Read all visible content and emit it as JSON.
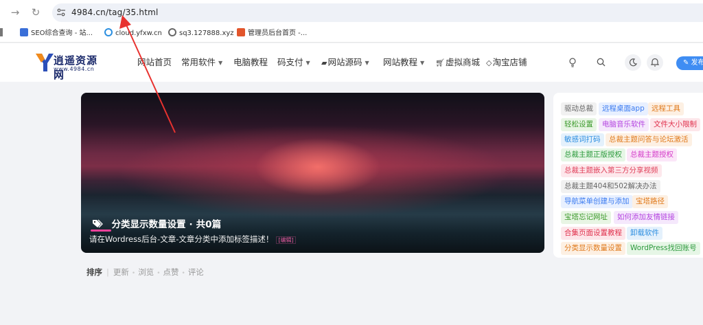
{
  "browser": {
    "address": "4984.cn/tag/35.html",
    "bookmarks": [
      {
        "label": "SEO综合查询 - 站...",
        "icon": "seo-favicon",
        "color": "#3a6fd8"
      },
      {
        "label": "cloud.yfxw.cn",
        "icon": "cloud-favicon",
        "color": "#2b8fe0"
      },
      {
        "label": "sq3.127888.xyz",
        "icon": "globe-icon",
        "color": "#666666"
      },
      {
        "label": "管理员后台首页 -...",
        "icon": "k-favicon",
        "color": "#e2552b"
      }
    ]
  },
  "site": {
    "logo_title": "逍遥资源网",
    "logo_sub": "www.4984.cn",
    "menu": [
      {
        "label": "网站首页",
        "glyph": "",
        "caret": false
      },
      {
        "label": "常用软件",
        "glyph": "",
        "caret": true
      },
      {
        "label": "电脑教程",
        "glyph": "",
        "caret": false
      },
      {
        "label": "码支付",
        "glyph": "",
        "caret": true
      },
      {
        "label": "网站源码",
        "glyph": "folder-icon",
        "caret": true
      },
      {
        "label": "网站教程",
        "glyph": "",
        "caret": true
      },
      {
        "label": "虚拟商城",
        "glyph": "cart-icon",
        "caret": false
      },
      {
        "label": "淘宝店铺",
        "glyph": "diamond-icon",
        "caret": false
      }
    ],
    "publish_label": "✎ 发布"
  },
  "banner": {
    "tag_name": "分类显示数量设置",
    "count_text": "共0篇",
    "description": "请在Wordress后台-文章-文章分类中添加标签描述！",
    "edit_label": "[编辑]"
  },
  "sort": {
    "label": "排序",
    "options": [
      "更新",
      "浏览",
      "点赞",
      "评论"
    ]
  },
  "tags": [
    {
      "label": "驱动总裁",
      "color": "#666666",
      "bg": "#f1f1f1"
    },
    {
      "label": "远程桌面app",
      "color": "#3b7bf0",
      "bg": "#e8f0ff"
    },
    {
      "label": "远程工具",
      "color": "#e07a1c",
      "bg": "#fdf0e3"
    },
    {
      "label": "轻松设置",
      "color": "#3c9a2c",
      "bg": "#e8f5e4"
    },
    {
      "label": "电脑音乐软件",
      "color": "#b445e0",
      "bg": "#f5e8fc"
    },
    {
      "label": "文件大小限制",
      "color": "#e0304c",
      "bg": "#fde6ea"
    },
    {
      "label": "敏感词打码",
      "color": "#2d8ee0",
      "bg": "#e4f1fc"
    },
    {
      "label": "总裁主题问答与论坛激活",
      "color": "#e07a1c",
      "bg": "#fdf0e3"
    },
    {
      "label": "总裁主题正版授权",
      "color": "#2c9a3c",
      "bg": "#e6f6e6"
    },
    {
      "label": "总裁主题授权",
      "color": "#d43cc8",
      "bg": "#fbe6f8"
    },
    {
      "label": "总裁主题嵌入第三方分享视频",
      "color": "#e0405a",
      "bg": "#fde8ec"
    },
    {
      "label": "总裁主题404和502解决办法",
      "color": "#666666",
      "bg": "#f1f1f1"
    },
    {
      "label": "导航菜单创建与添加",
      "color": "#3b7bf0",
      "bg": "#e8f0ff"
    },
    {
      "label": "宝塔路径",
      "color": "#e07a1c",
      "bg": "#fdf0e3"
    },
    {
      "label": "宝塔忘记网址",
      "color": "#3c9a2c",
      "bg": "#e8f5e4"
    },
    {
      "label": "如何添加友情链接",
      "color": "#b445e0",
      "bg": "#f5e8fc"
    },
    {
      "label": "合集页面设置教程",
      "color": "#e0304c",
      "bg": "#fde6ea"
    },
    {
      "label": "卸载软件",
      "color": "#2d8ee0",
      "bg": "#e4f1fc"
    },
    {
      "label": "分类显示数量设置",
      "color": "#e07a1c",
      "bg": "#fdf0e3"
    },
    {
      "label": "WordPress找回账号",
      "color": "#2c9a3c",
      "bg": "#e6f6e6"
    }
  ]
}
